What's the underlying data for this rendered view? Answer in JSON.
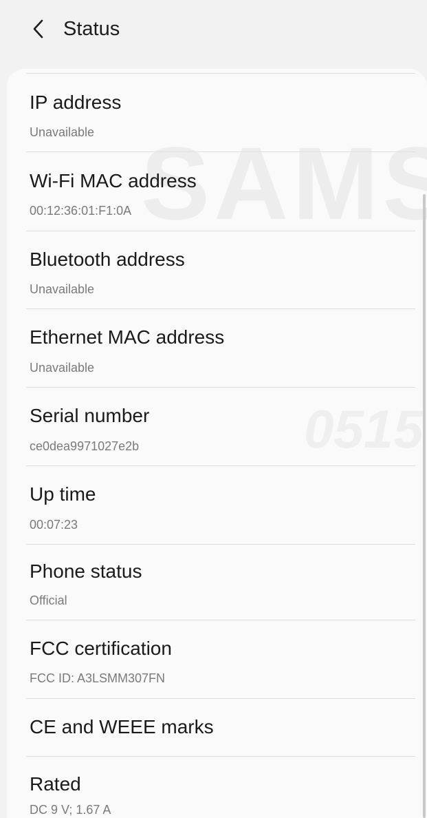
{
  "header": {
    "title": "Status",
    "back_icon": "chevron-left-icon"
  },
  "watermark": {
    "brand": "SAMS",
    "number": "0515"
  },
  "items": [
    {
      "label": "IP address",
      "value": "Unavailable"
    },
    {
      "label": "Wi-Fi MAC address",
      "value": "00:12:36:01:F1:0A"
    },
    {
      "label": "Bluetooth address",
      "value": "Unavailable"
    },
    {
      "label": "Ethernet MAC address",
      "value": "Unavailable"
    },
    {
      "label": "Serial number",
      "value": "ce0dea9971027e2b"
    },
    {
      "label": "Up time",
      "value": "00:07:23"
    },
    {
      "label": "Phone status",
      "value": "Official"
    },
    {
      "label": "FCC certification",
      "value": "FCC ID: A3LSMM307FN"
    },
    {
      "label": "CE and WEEE marks"
    },
    {
      "label": "Rated",
      "value": "DC 9 V; 1.67 A"
    }
  ],
  "colors": {
    "background": "#f2f2f2",
    "card": "#fafafa",
    "title_text": "#1a1a1a",
    "value_text": "#7a7a7a",
    "divider": "#dedede"
  }
}
